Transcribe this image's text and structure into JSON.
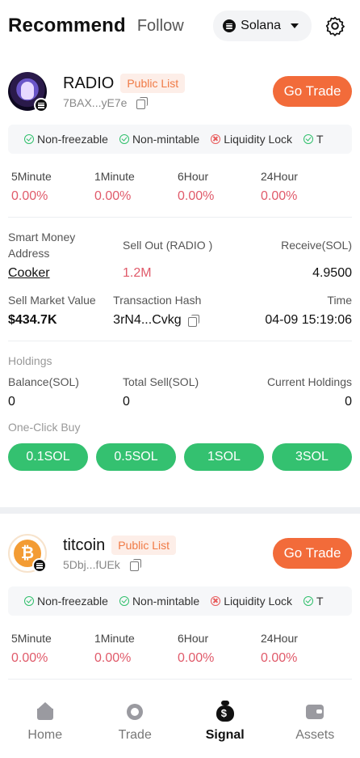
{
  "header": {
    "tab_recommend": "Recommend",
    "tab_follow": "Follow",
    "chain": "Solana"
  },
  "cards": [
    {
      "name": "RADIO",
      "badge": "Public List",
      "address": "7BAX...yE7e",
      "go_trade": "Go Trade",
      "tags": [
        "Non-freezable",
        "Non-mintable",
        "Liquidity Lock",
        "T"
      ],
      "timeframes": [
        {
          "label": "5Minute",
          "value": "0.00%"
        },
        {
          "label": "1Minute",
          "value": "0.00%"
        },
        {
          "label": "6Hour",
          "value": "0.00%"
        },
        {
          "label": "24Hour",
          "value": "0.00%"
        }
      ],
      "smart_money_label": "Smart Money Address",
      "smart_money_value": "Cooker",
      "sell_out_label": "Sell Out (RADIO )",
      "sell_out_value": "1.2M",
      "receive_label": "Receive(SOL)",
      "receive_value": "4.9500",
      "market_value_label": "Sell Market Value",
      "market_value": "$434.7K",
      "tx_hash_label": "Transaction Hash",
      "tx_hash": "3rN4...Cvkg",
      "time_label": "Time",
      "time": "04-09 15:19:06",
      "holdings_label": "Holdings",
      "balance_label": "Balance(SOL)",
      "balance": "0",
      "total_sell_label": "Total Sell(SOL)",
      "total_sell": "0",
      "current_holdings_label": "Current Holdings",
      "current_holdings": "0",
      "one_click_label": "One-Click Buy",
      "buy_options": [
        "0.1SOL",
        "0.5SOL",
        "1SOL",
        "3SOL"
      ]
    },
    {
      "name": "titcoin",
      "badge": "Public List",
      "address": "5Dbj...fUEk",
      "go_trade": "Go Trade",
      "tags": [
        "Non-freezable",
        "Non-mintable",
        "Liquidity Lock",
        "T"
      ],
      "timeframes": [
        {
          "label": "5Minute",
          "value": "0.00%"
        },
        {
          "label": "1Minute",
          "value": "0.00%"
        },
        {
          "label": "6Hour",
          "value": "0.00%"
        },
        {
          "label": "24Hour",
          "value": "0.00%"
        }
      ]
    }
  ],
  "nav": [
    {
      "label": "Home",
      "icon": "home-icon"
    },
    {
      "label": "Trade",
      "icon": "trade-icon"
    },
    {
      "label": "Signal",
      "icon": "signal-icon",
      "active": true
    },
    {
      "label": "Assets",
      "icon": "assets-icon"
    }
  ],
  "colors": {
    "accent": "#f26b3a",
    "buy": "#34c170",
    "negative": "#e05a6a"
  }
}
